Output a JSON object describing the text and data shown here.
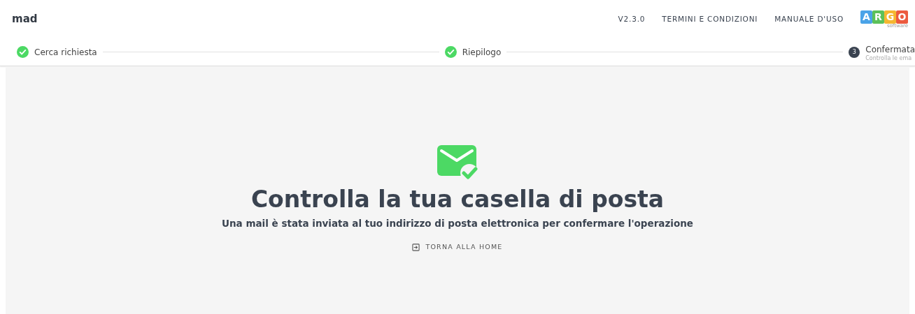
{
  "header": {
    "brand": "mad",
    "links": [
      "V2.3.0",
      "TERMINI E CONDIZIONI",
      "MANUALE D'USO"
    ],
    "logo": {
      "tiles": [
        {
          "letter": "A",
          "color": "#4aa3e8"
        },
        {
          "letter": "R",
          "color": "#5cc15a"
        },
        {
          "letter": "G",
          "color": "#f5b731"
        },
        {
          "letter": "O",
          "color": "#ec5a3f"
        }
      ],
      "caption": "software"
    }
  },
  "steps": [
    {
      "label": "Cerca richiesta",
      "completed": true
    },
    {
      "label": "Riepilogo",
      "completed": true
    },
    {
      "label": "Confermata",
      "number": "3",
      "subtitle": "Controlla le ema",
      "completed": false
    }
  ],
  "main": {
    "title": "Controlla la tua casella di posta",
    "message": "Una mail è stata inviata al tuo indirizzo di posta elettronica per confermare l'operazione",
    "button": "TORNA ALLA HOME"
  }
}
